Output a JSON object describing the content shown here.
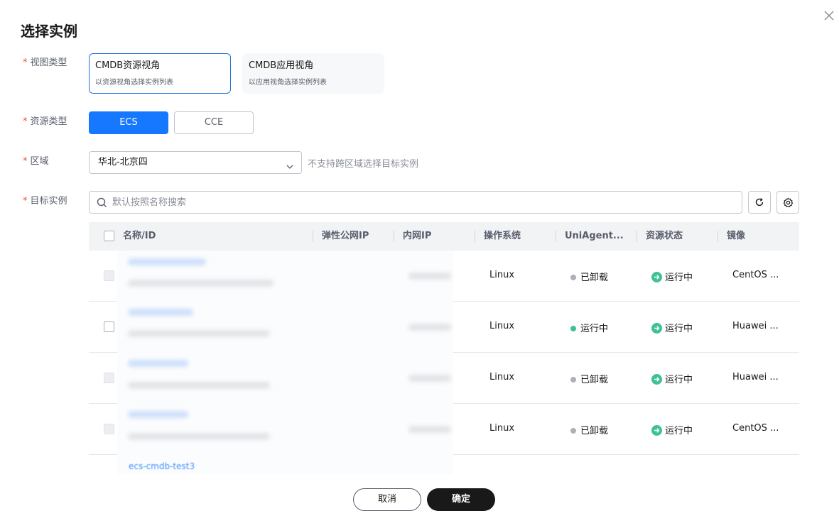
{
  "dialog": {
    "title": "选择实例",
    "close_icon": "close-icon"
  },
  "form": {
    "view_type": {
      "label": "视图类型",
      "options": [
        {
          "title": "CMDB资源视角",
          "desc": "以资源视角选择实例列表",
          "selected": true
        },
        {
          "title": "CMDB应用视角",
          "desc": "以应用视角选择实例列表",
          "selected": false
        }
      ]
    },
    "resource_type": {
      "label": "资源类型",
      "options": [
        {
          "label": "ECS",
          "selected": true
        },
        {
          "label": "CCE",
          "selected": false
        }
      ]
    },
    "region": {
      "label": "区域",
      "value": "华北-北京四",
      "hint": "不支持跨区域选择目标实例"
    },
    "target": {
      "label": "目标实例",
      "search_placeholder": "默认按照名称搜索"
    }
  },
  "table": {
    "columns": [
      "名称/ID",
      "弹性公网IP",
      "内网IP",
      "操作系统",
      "UniAgent...",
      "资源状态",
      "镜像"
    ],
    "rows": [
      {
        "os": "Linux",
        "agent": "已卸载",
        "agent_status": "uninstalled",
        "status": "运行中",
        "image": "CentOS ...",
        "checkbox_disabled": true
      },
      {
        "os": "Linux",
        "agent": "运行中",
        "agent_status": "running",
        "status": "运行中",
        "image": "Huawei ...",
        "checkbox_disabled": false
      },
      {
        "os": "Linux",
        "agent": "已卸载",
        "agent_status": "uninstalled",
        "status": "运行中",
        "image": "Huawei ...",
        "checkbox_disabled": true
      },
      {
        "os": "Linux",
        "agent": "已卸载",
        "agent_status": "uninstalled",
        "status": "运行中",
        "image": "CentOS ...",
        "checkbox_disabled": true
      }
    ],
    "truncated_next_row_name": "ecs-cmdb-test3"
  },
  "footer": {
    "cancel_label": "取消",
    "ok_label": "确定"
  },
  "colors": {
    "primary": "#1677ff",
    "required": "#e84e40",
    "agent_running": "#3ec195",
    "agent_uninstalled": "#adb0b8"
  }
}
